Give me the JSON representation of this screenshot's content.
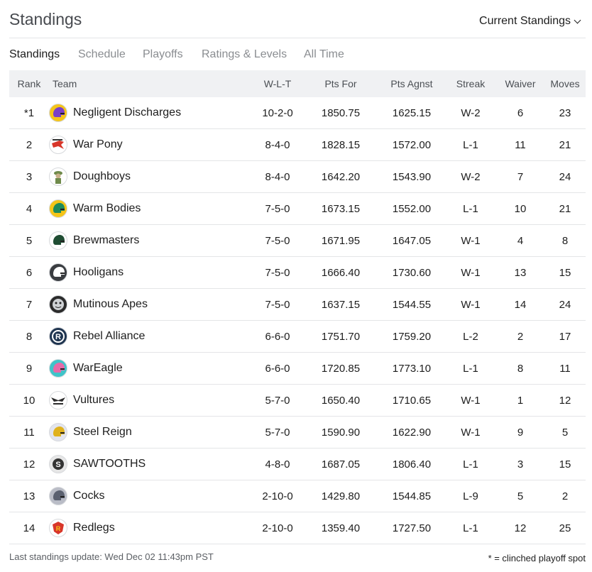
{
  "header": {
    "title": "Standings",
    "view_select": "Current Standings"
  },
  "tabs": [
    {
      "label": "Standings",
      "active": true
    },
    {
      "label": "Schedule",
      "active": false
    },
    {
      "label": "Playoffs",
      "active": false
    },
    {
      "label": "Ratings & Levels",
      "active": false
    },
    {
      "label": "All Time",
      "active": false
    }
  ],
  "columns": [
    "Rank",
    "Team",
    "W-L-T",
    "Pts For",
    "Pts Agnst",
    "Streak",
    "Waiver",
    "Moves"
  ],
  "rows": [
    {
      "rank": "*1",
      "team": "Negligent Discharges",
      "wlt": "10-2-0",
      "pf": "1850.75",
      "pa": "1625.15",
      "streak": "W-2",
      "waiver": "6",
      "moves": "23",
      "logo": {
        "icon": "helmet-icon",
        "bg": "#f5c518",
        "fg": "#7a3fc7"
      }
    },
    {
      "rank": "2",
      "team": "War Pony",
      "wlt": "8-4-0",
      "pf": "1828.15",
      "pa": "1572.00",
      "streak": "L-1",
      "waiver": "11",
      "moves": "21",
      "logo": {
        "icon": "pony-icon",
        "bg": "#ffffff",
        "fg": "#d8362a"
      }
    },
    {
      "rank": "3",
      "team": "Doughboys",
      "wlt": "8-4-0",
      "pf": "1642.20",
      "pa": "1543.90",
      "streak": "W-2",
      "waiver": "7",
      "moves": "24",
      "logo": {
        "icon": "soldier-icon",
        "bg": "#ffffff",
        "fg": "#6f8a4b"
      }
    },
    {
      "rank": "4",
      "team": "Warm Bodies",
      "wlt": "7-5-0",
      "pf": "1673.15",
      "pa": "1552.00",
      "streak": "L-1",
      "waiver": "10",
      "moves": "21",
      "logo": {
        "icon": "helmet-icon",
        "bg": "#f5c518",
        "fg": "#1e8a5c"
      }
    },
    {
      "rank": "5",
      "team": "Brewmasters",
      "wlt": "7-5-0",
      "pf": "1671.95",
      "pa": "1647.05",
      "streak": "W-1",
      "waiver": "4",
      "moves": "8",
      "logo": {
        "icon": "helmet-icon",
        "bg": "#ffffff",
        "fg": "#1f4d33"
      }
    },
    {
      "rank": "6",
      "team": "Hooligans",
      "wlt": "7-5-0",
      "pf": "1666.40",
      "pa": "1730.60",
      "streak": "W-1",
      "waiver": "13",
      "moves": "15",
      "logo": {
        "icon": "helmet-icon",
        "bg": "#3a3d41",
        "fg": "#ffffff"
      }
    },
    {
      "rank": "7",
      "team": "Mutinous Apes",
      "wlt": "7-5-0",
      "pf": "1637.15",
      "pa": "1544.55",
      "streak": "W-1",
      "waiver": "14",
      "moves": "24",
      "logo": {
        "icon": "ape-icon",
        "bg": "#2b2b2b",
        "fg": "#cfd2d5"
      }
    },
    {
      "rank": "8",
      "team": "Rebel Alliance",
      "wlt": "6-6-0",
      "pf": "1751.70",
      "pa": "1759.20",
      "streak": "L-2",
      "waiver": "2",
      "moves": "17",
      "logo": {
        "icon": "rebel-r-icon",
        "bg": "#1f3550",
        "fg": "#ffffff"
      }
    },
    {
      "rank": "9",
      "team": "WarEagle",
      "wlt": "6-6-0",
      "pf": "1720.85",
      "pa": "1773.10",
      "streak": "L-1",
      "waiver": "8",
      "moves": "11",
      "logo": {
        "icon": "helmet-icon",
        "bg": "#3fc4c9",
        "fg": "#e76aa8"
      }
    },
    {
      "rank": "10",
      "team": "Vultures",
      "wlt": "5-7-0",
      "pf": "1650.40",
      "pa": "1710.65",
      "streak": "W-1",
      "waiver": "1",
      "moves": "12",
      "logo": {
        "icon": "vulture-icon",
        "bg": "#ffffff",
        "fg": "#2b2b2b"
      }
    },
    {
      "rank": "11",
      "team": "Steel Reign",
      "wlt": "5-7-0",
      "pf": "1590.90",
      "pa": "1622.90",
      "streak": "W-1",
      "waiver": "9",
      "moves": "5",
      "logo": {
        "icon": "helmet-icon",
        "bg": "#e3e5ef",
        "fg": "#e0b21e"
      }
    },
    {
      "rank": "12",
      "team": "SAWTOOTHS",
      "wlt": "4-8-0",
      "pf": "1687.05",
      "pa": "1806.40",
      "streak": "L-1",
      "waiver": "3",
      "moves": "15",
      "logo": {
        "icon": "s-badge-icon",
        "bg": "#e6e6e6",
        "fg": "#333333"
      }
    },
    {
      "rank": "13",
      "team": "Cocks",
      "wlt": "2-10-0",
      "pf": "1429.80",
      "pa": "1544.85",
      "streak": "L-9",
      "waiver": "5",
      "moves": "2",
      "logo": {
        "icon": "helmet-icon",
        "bg": "#b9bcc6",
        "fg": "#5b6170"
      }
    },
    {
      "rank": "14",
      "team": "Redlegs",
      "wlt": "2-10-0",
      "pf": "1359.40",
      "pa": "1727.50",
      "streak": "L-1",
      "waiver": "12",
      "moves": "25",
      "logo": {
        "icon": "shield-icon",
        "bg": "#ffffff",
        "fg": "#d8362a"
      }
    }
  ],
  "footer": {
    "last_update": "Last standings update: Wed Dec 02 11:43pm PST",
    "legend": "* = clinched playoff spot"
  }
}
